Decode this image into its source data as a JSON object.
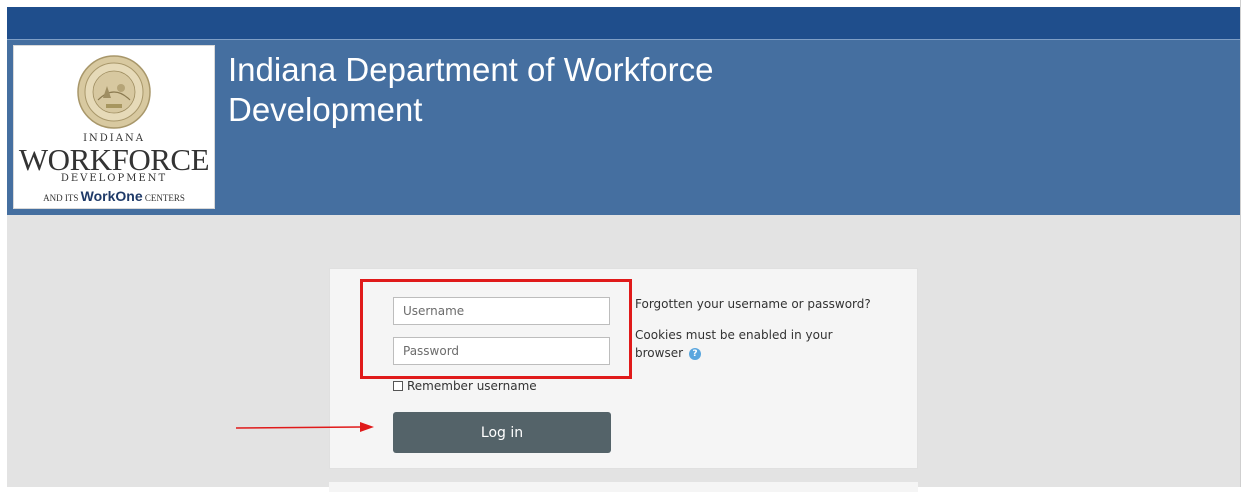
{
  "header": {
    "title": "Indiana Department of Workforce Development",
    "logo": {
      "line1": "INDIANA",
      "line2": "WORKFORCE",
      "line3": "DEVELOPMENT",
      "line4_prefix": "AND ITS ",
      "line4_work": "Work",
      "line4_one": "One",
      "line4_suffix": " CENTERS",
      "seal_icon": "indiana-state-seal-icon"
    }
  },
  "login": {
    "username_placeholder": "Username",
    "password_placeholder": "Password",
    "remember_label": "Remember username",
    "login_button": "Log in",
    "forgot_link": "Forgotten your username or password?",
    "cookies_text": "Cookies must be enabled in your browser",
    "help_icon": "question-help-icon"
  },
  "annotations": {
    "highlight_color": "#e01a1a",
    "arrow_color": "#e01a1a"
  },
  "colors": {
    "topbar": "#1f4e8c",
    "header": "#456fa0",
    "button": "#546369"
  }
}
